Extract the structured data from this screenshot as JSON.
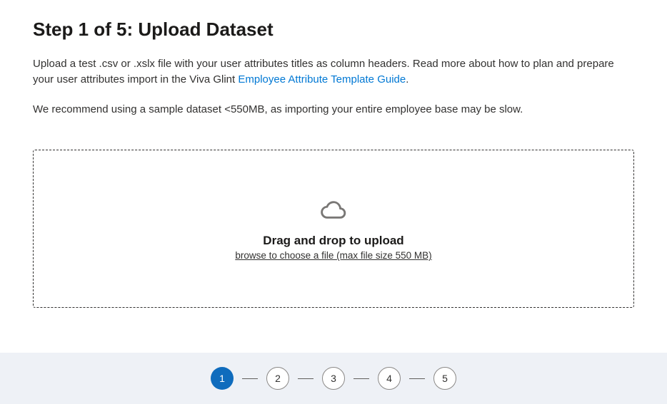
{
  "header": {
    "title": "Step 1 of 5: Upload Dataset"
  },
  "instructions": {
    "part1": "Upload a test .csv or .xslx file with your user attributes titles as column headers. Read more about how to plan and prepare your user attributes import in the Viva Glint ",
    "link_text": "Employee Attribute Template Guide",
    "part2": "."
  },
  "recommendation": "We recommend using a sample dataset <550MB, as importing your entire employee base may be slow.",
  "upload": {
    "heading": "Drag and drop to upload",
    "sub": "browse to choose a file (max file size 550 MB)"
  },
  "stepper": {
    "steps": [
      "1",
      "2",
      "3",
      "4",
      "5"
    ],
    "current": 1
  }
}
